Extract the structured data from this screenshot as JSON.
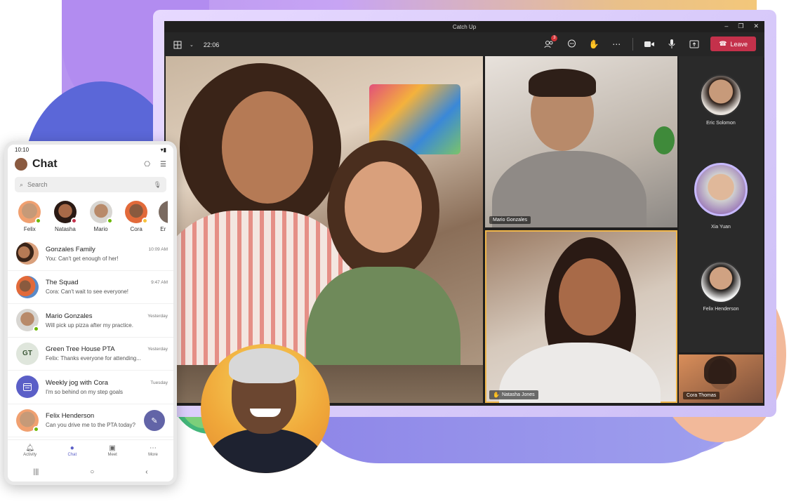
{
  "meeting": {
    "title": "Catch Up",
    "timer": "22:06",
    "participants_badge": "3",
    "leave_label": "Leave",
    "window_controls": [
      "–",
      "❐",
      "✕"
    ],
    "toolbar_icons": [
      "people-icon",
      "chat-icon",
      "raise-hand-icon",
      "more-icon",
      "camera-icon",
      "mic-icon",
      "share-icon"
    ],
    "tiles": [
      {
        "name": "Mario Gonzales"
      },
      {
        "name": "Natasha Jones",
        "hand_raised": true
      },
      {
        "name": "Cora Thomas"
      }
    ],
    "sidebar": [
      {
        "name": "Eric Solomon"
      },
      {
        "name": "Xia Yuan",
        "active": true
      },
      {
        "name": "Felix Henderson"
      }
    ],
    "colors": {
      "leave": "#c4314b",
      "highlight": "#f0b64a",
      "accent": "#6264a7"
    }
  },
  "phone": {
    "time": "10:10",
    "title": "Chat",
    "search_placeholder": "Search",
    "recent": [
      {
        "name": "Felix",
        "status": "available"
      },
      {
        "name": "Natasha",
        "status": "busy"
      },
      {
        "name": "Mario",
        "status": "available"
      },
      {
        "name": "Cora",
        "status": "away"
      },
      {
        "name": "Er",
        "status": "none"
      }
    ],
    "chats": [
      {
        "name": "Gonzales Family",
        "time": "10:09 AM",
        "message": "You: Can't get enough of her!",
        "avatar": "group"
      },
      {
        "name": "The Squad",
        "time": "9:47 AM",
        "message": "Cora: Can't wait to see everyone!",
        "avatar": "group"
      },
      {
        "name": "Mario Gonzales",
        "time": "Yesterday",
        "message": "Will pick up pizza after my practice.",
        "avatar": "person"
      },
      {
        "name": "Green Tree House PTA",
        "time": "Yesterday",
        "message": "Felix: Thanks everyone for attending...",
        "avatar": "GT"
      },
      {
        "name": "Weekly jog with Cora",
        "time": "Tuesday",
        "message": "I'm so behind on my step goals",
        "avatar": "calendar"
      },
      {
        "name": "Felix Henderson",
        "time": "",
        "message": "Can you drive me to the PTA today?",
        "avatar": "person"
      }
    ],
    "tabs": [
      {
        "label": "Activity",
        "icon": "bell-icon"
      },
      {
        "label": "Chat",
        "icon": "chat-icon",
        "active": true
      },
      {
        "label": "Meet",
        "icon": "meet-icon"
      },
      {
        "label": "More",
        "icon": "more-icon"
      }
    ]
  }
}
